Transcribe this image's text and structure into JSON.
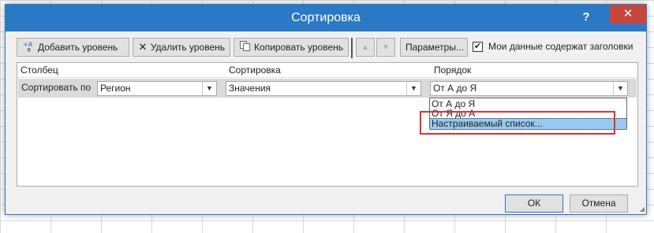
{
  "dialog": {
    "title": "Сортировка",
    "help_label": "?",
    "close_label": "✕"
  },
  "toolbar": {
    "add_level": "Добавить уровень",
    "delete_level": "Удалить уровень",
    "copy_level": "Копировать уровень",
    "move_up": "▲",
    "move_down": "▼",
    "options": "Параметры...",
    "headers_checkbox_label": "Мои данные содержат заголовки",
    "headers_checked": "✔"
  },
  "columns": {
    "column": "Столбец",
    "sort_on": "Сортировка",
    "order": "Порядок"
  },
  "row": {
    "label": "Сортировать по",
    "column_value": "Регион",
    "sort_on_value": "Значения",
    "order_value": "От А до Я"
  },
  "order_options": [
    "От А до Я",
    "От Я до А",
    "Настраиваемый список..."
  ],
  "footer": {
    "ok": "ОК",
    "cancel": "Отмена"
  },
  "icons": {
    "add": "add-level-icon",
    "delete": "delete-x-icon",
    "copy": "copy-icon",
    "dropdown": "chevron-down-icon"
  },
  "colors": {
    "titlebar": "#2b78c5",
    "close": "#c9463d",
    "highlight": "#99c9ef",
    "annotation": "#e03131"
  }
}
